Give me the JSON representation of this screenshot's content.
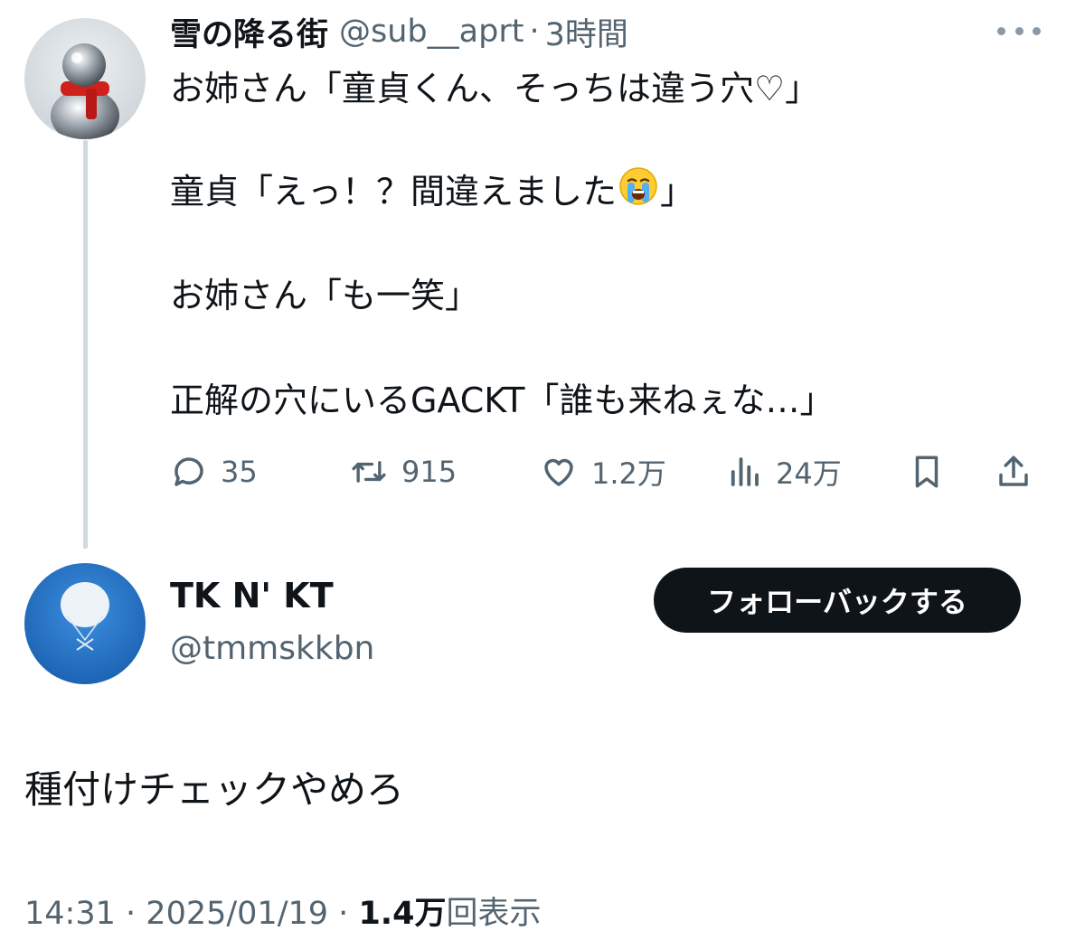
{
  "original_tweet": {
    "display_name": "雪の降る街",
    "handle": "@sub__aprt",
    "separator": "·",
    "time": "3時間",
    "lines": [
      "お姉さん「童貞くん、そっちは違う穴♡」",
      "童貞「えっ！？間違えました",
      "お姉さん「も一笑」",
      "正解の穴にいるGACKT「誰も来ねぇな…」"
    ],
    "line2_end": "」",
    "line2_emoji": "loudly-crying-face",
    "stats": {
      "replies": "35",
      "retweets": "915",
      "likes": "1.2万",
      "views": "24万"
    },
    "icons": [
      "more-icon",
      "reply-icon",
      "retweet-icon",
      "like-icon",
      "views-icon",
      "bookmark-icon",
      "share-icon"
    ]
  },
  "reply_tweet": {
    "display_name": "TK N' KT",
    "handle": "@tmmskkbn",
    "follow_button_label": "フォローバックする",
    "text": "種付けチェックやめろ",
    "meta": {
      "time": "14:31",
      "date": "2025/01/19",
      "separator": "·",
      "views_count": "1.4万",
      "views_label": "回表示"
    }
  },
  "colors": {
    "text_primary": "#0f1419",
    "text_secondary": "#536471",
    "thread_line": "#cfd9de",
    "button_bg": "#0f1419",
    "button_text": "#ffffff",
    "avatar2_bg": "#1f6fc4"
  }
}
